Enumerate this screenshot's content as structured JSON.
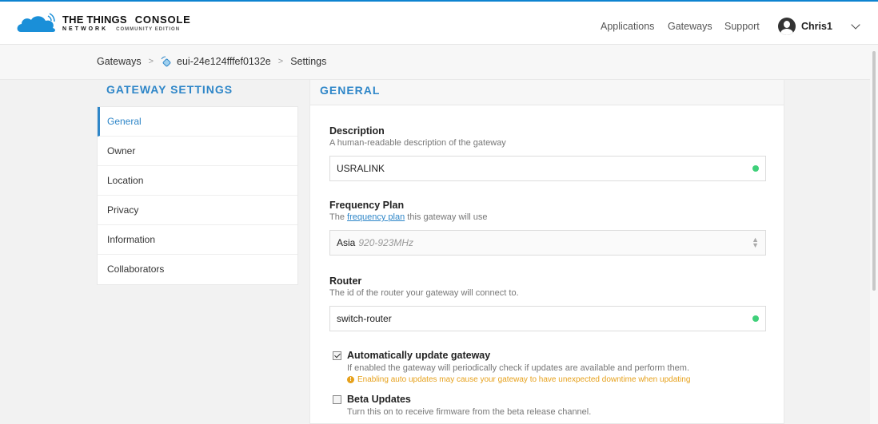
{
  "header": {
    "brand_line1": "THE THINGS",
    "brand_console": "CONSOLE",
    "brand_line2": "NETWORK",
    "brand_edition": "COMMUNITY EDITION",
    "nav": {
      "applications": "Applications",
      "gateways": "Gateways",
      "support": "Support"
    },
    "user": "Chris1"
  },
  "breadcrumb": [
    "Gateways",
    "eui-24e124fffef0132e",
    "Settings"
  ],
  "sidebar": {
    "title": "GATEWAY SETTINGS",
    "items": [
      {
        "label": "General",
        "active": true
      },
      {
        "label": "Owner"
      },
      {
        "label": "Location"
      },
      {
        "label": "Privacy"
      },
      {
        "label": "Information"
      },
      {
        "label": "Collaborators"
      }
    ]
  },
  "main": {
    "title": "GENERAL",
    "description": {
      "label": "Description",
      "help": "A human-readable description of the gateway",
      "value": "USRALINK"
    },
    "frequency": {
      "label": "Frequency Plan",
      "help_prefix": "The",
      "help_link": "frequency plan",
      "help_suffix": "this gateway will use",
      "value": "Asia",
      "value_sub": "920-923MHz"
    },
    "router": {
      "label": "Router",
      "help": "The id of the router your gateway will connect to.",
      "value": "switch-router"
    },
    "auto_update": {
      "checked": true,
      "label": "Automatically update gateway",
      "desc": "If enabled the gateway will periodically check if updates are available and perform them.",
      "warning": "Enabling auto updates may cause your gateway to have unexpected downtime when updating"
    },
    "beta": {
      "checked": false,
      "label": "Beta Updates",
      "desc": "Turn this on to receive firmware from the beta release channel."
    }
  },
  "colors": {
    "accent": "#2e86c8",
    "ok": "#3fd07a",
    "warning": "#e6a11c",
    "logo": "#1a8fd8"
  }
}
